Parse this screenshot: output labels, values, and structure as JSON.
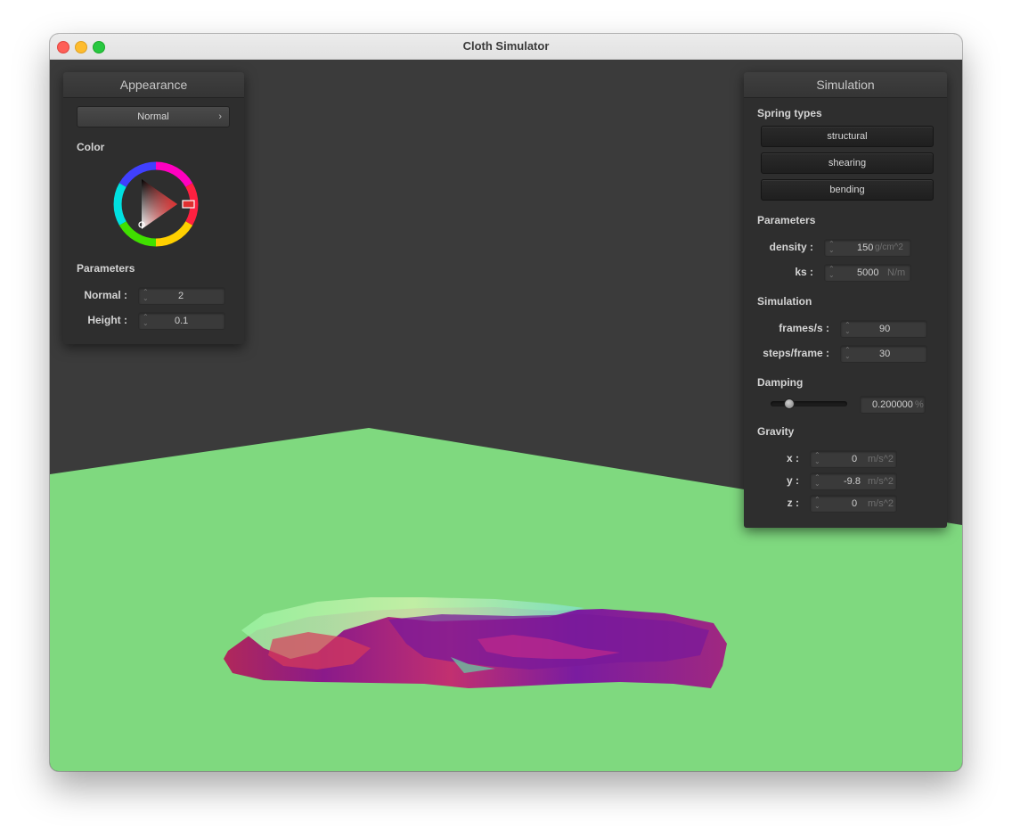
{
  "window": {
    "title": "Cloth Simulator"
  },
  "colors": {
    "background_wall": "#3b3b3b",
    "floor": "#7fd97f",
    "panel": "#2e2e2e",
    "selected_color": "#e03030"
  },
  "appearance": {
    "title": "Appearance",
    "shader": "Normal",
    "color_label": "Color",
    "parameters_label": "Parameters",
    "normal_label": "Normal :",
    "normal_value": "2",
    "height_label": "Height :",
    "height_value": "0.1"
  },
  "simulation": {
    "title": "Simulation",
    "spring_types_label": "Spring types",
    "springs": [
      "structural",
      "shearing",
      "bending"
    ],
    "parameters_label": "Parameters",
    "density_label": "density :",
    "density_value": "150",
    "density_unit": "g/cm^2",
    "ks_label": "ks :",
    "ks_value": "5000",
    "ks_unit": "N/m",
    "simulation_label": "Simulation",
    "fps_label": "frames/s :",
    "fps_value": "90",
    "steps_label": "steps/frame :",
    "steps_value": "30",
    "damping_label": "Damping",
    "damping_value": "0.200000",
    "damping_unit": "%",
    "damping_fraction": 0.2,
    "gravity_label": "Gravity",
    "gx_label": "x :",
    "gx_value": "0",
    "gy_label": "y :",
    "gy_value": "-9.8",
    "gz_label": "z :",
    "gz_value": "0",
    "gravity_unit": "m/s^2"
  }
}
